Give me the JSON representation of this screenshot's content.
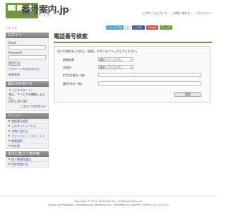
{
  "header": {
    "title": "番号案内.jp",
    "version": "Ver. 1.0",
    "subtitle": "電話番号案内サービス",
    "links": [
      "このサイトについて",
      "お問い合わせ",
      "プライバシー"
    ]
  },
  "breadcrumb": "» トップ",
  "share": {
    "tweet": "ツイートする",
    "count": "0",
    "like": "いいね！",
    "google": "Google",
    "check": "チェック"
  },
  "sidebar": {
    "login": {
      "heading": "ログイン",
      "email_label": "Email",
      "password_label": "Password",
      "button": "ログイン",
      "forgot_link": "パスワードをお忘れの方",
      "register_link": "新規登録"
    },
    "news": {
      "heading": "最近のお知らせ",
      "item_text": "サービススタート！",
      "item_text2": "本日、サービスを開始しました。",
      "item_date": "[2011.09.28]",
      "more": "これまでのお知らせ"
    },
    "menu": {
      "heading": "メニュー",
      "items": [
        "電話番号検索",
        "このサイトについて",
        "お問い合わせ",
        "プライバシー・ステートメント",
        "利用規約",
        "料金表"
      ]
    },
    "support": {
      "heading": "法令に基づく表示等",
      "items": [
        "個人情報保護法",
        "特定商取引法"
      ]
    }
  },
  "main": {
    "title": "電話番号検索",
    "instruction": "全ての項目を入力の上「検索」ボタンをクリックしてください。",
    "fields": {
      "prefecture_label": "都道府県",
      "prefecture_value": "選択してください",
      "city_label": "市区町",
      "city_value": "選択してください",
      "town_label": "町丁目(前方一致)",
      "name_label": "番号(完全一致)"
    },
    "search_button": "検索"
  },
  "footer": {
    "copyright": "Copyright © 2011. NetPerfect Inc., All Rights Reserved",
    "credits": "Design by ProDesign | Developed by NetPerfect Inc. | Powered by CakePHP | XHTML 1.0 | CSS 2.0"
  }
}
